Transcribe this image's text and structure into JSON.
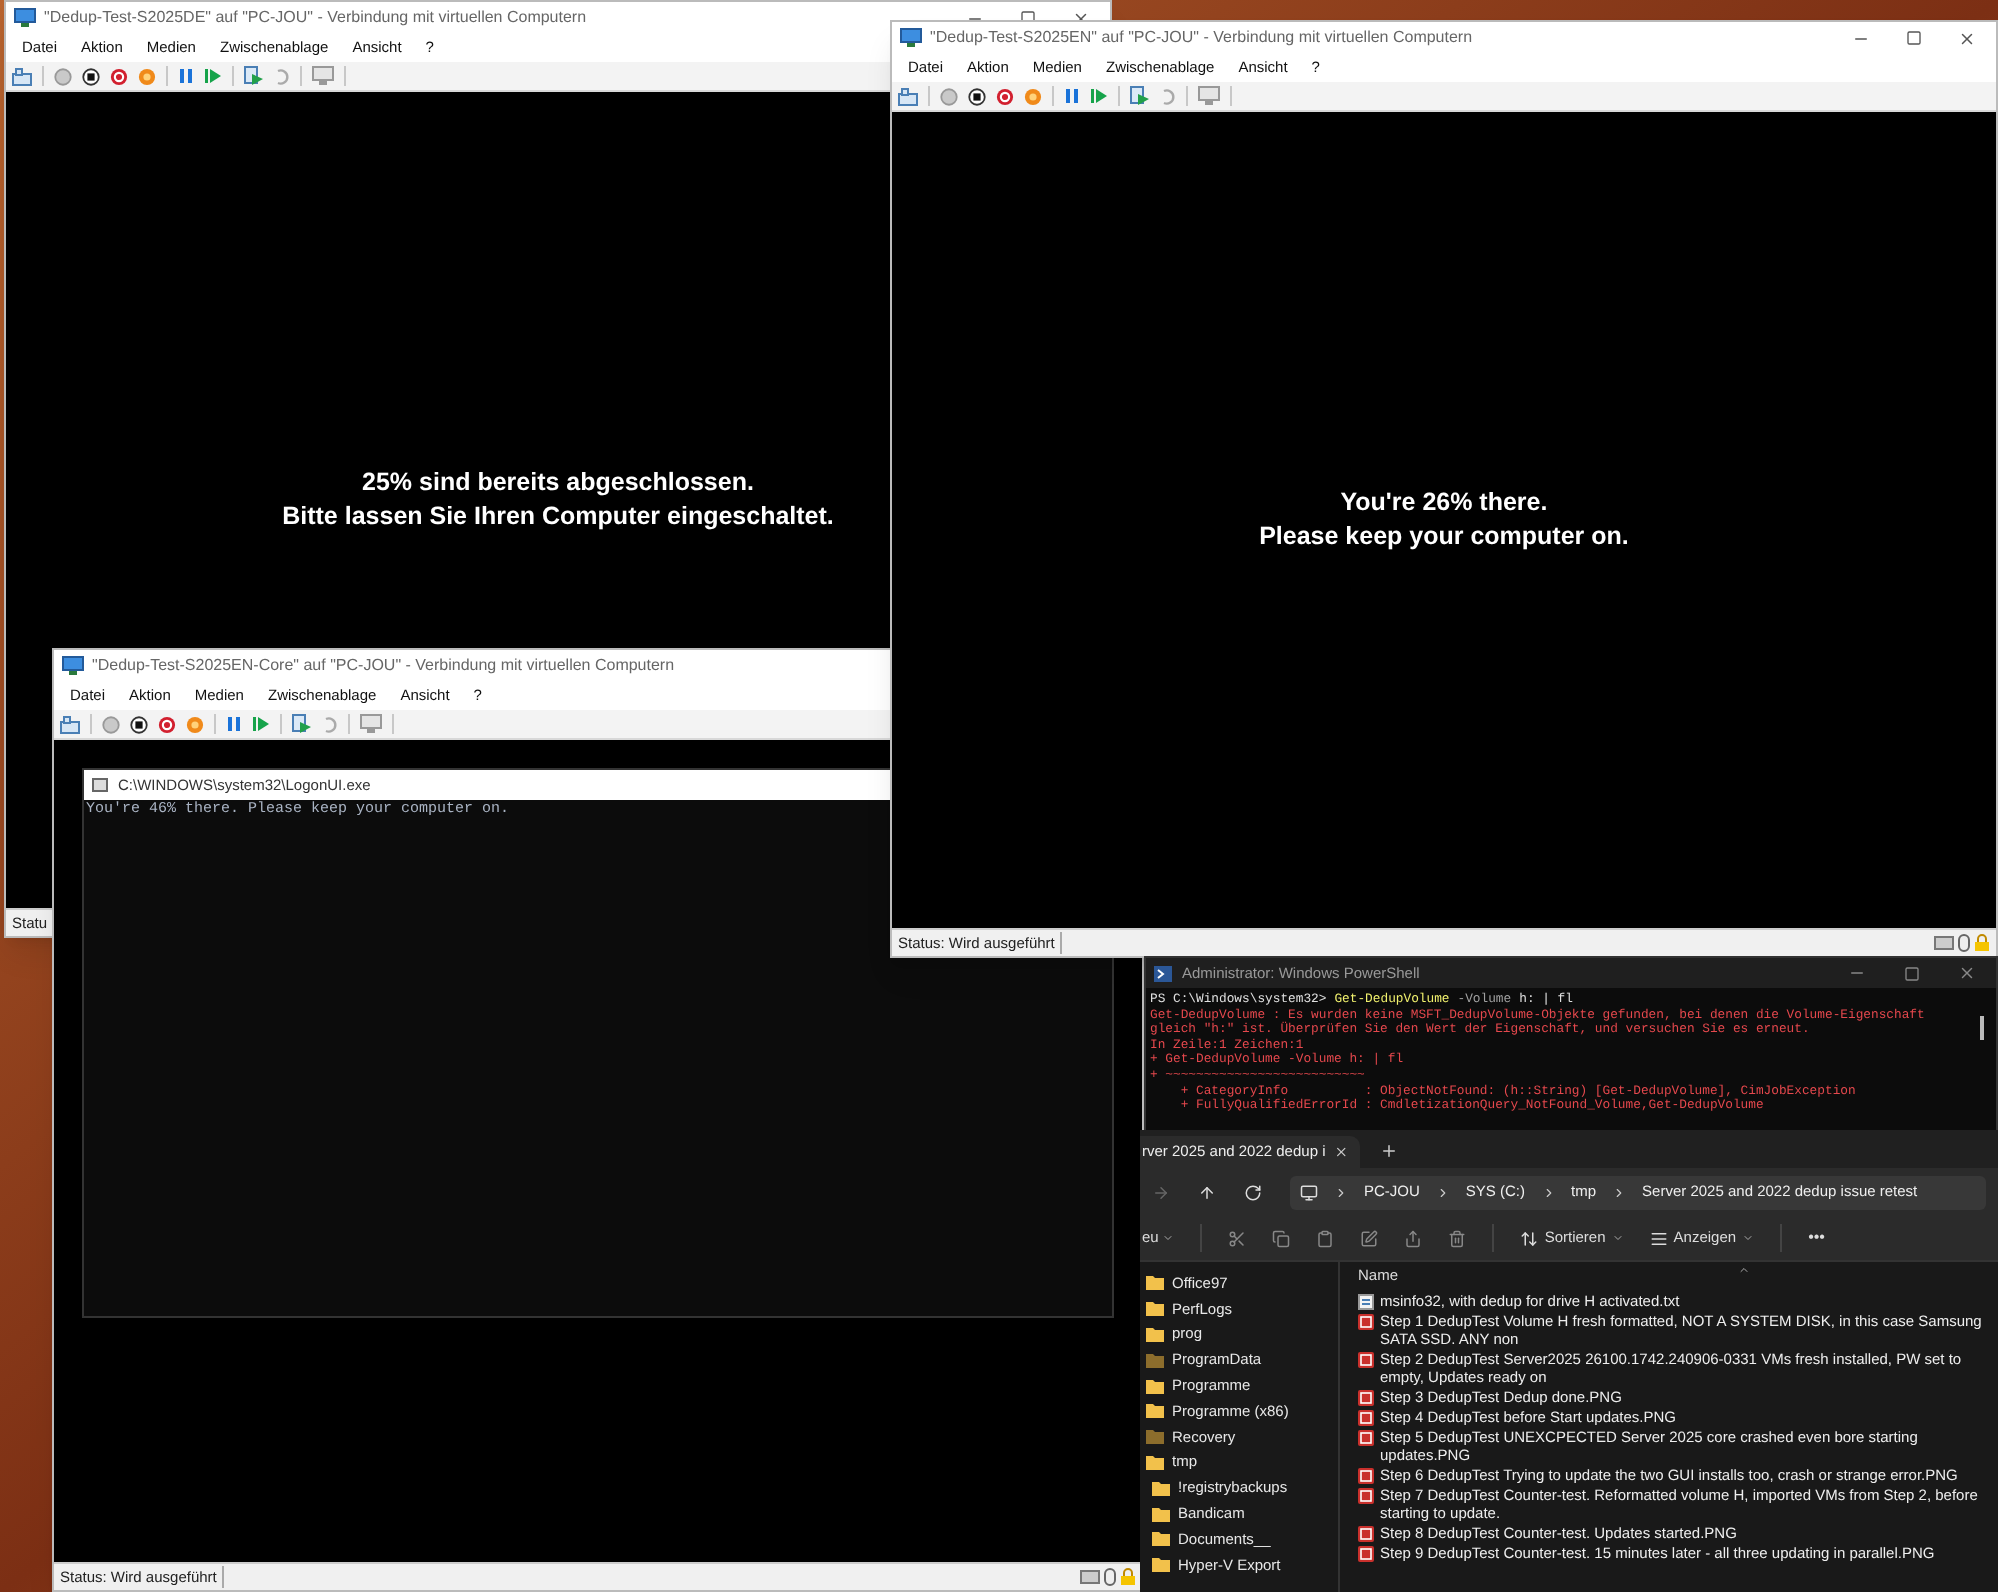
{
  "vm_windows": [
    {
      "title": "\"Dedup-Test-S2025DE\" auf \"PC-JOU\" - Verbindung mit virtuellen Computern",
      "menu": [
        "Datei",
        "Aktion",
        "Medien",
        "Zwischenablage",
        "Ansicht",
        "?"
      ],
      "screen": {
        "kind": "message",
        "lines": [
          "25% sind bereits abgeschlossen.",
          "Bitte lassen Sie Ihren Computer eingeschaltet."
        ]
      },
      "status": "Statu"
    },
    {
      "title": "\"Dedup-Test-S2025EN-Core\" auf \"PC-JOU\" - Verbindung mit virtuellen Computern",
      "menu": [
        "Datei",
        "Aktion",
        "Medien",
        "Zwischenablage",
        "Ansicht",
        "?"
      ],
      "screen": {
        "kind": "console",
        "console_title": "C:\\WINDOWS\\system32\\LogonUI.exe",
        "lines": [
          "You're 46% there. Please keep your computer on."
        ]
      },
      "status": "Status: Wird ausgeführt"
    },
    {
      "title": "\"Dedup-Test-S2025EN\" auf \"PC-JOU\" - Verbindung mit virtuellen Computern",
      "menu": [
        "Datei",
        "Aktion",
        "Medien",
        "Zwischenablage",
        "Ansicht",
        "?"
      ],
      "screen": {
        "kind": "message",
        "lines": [
          "You're 26% there.",
          "Please keep your computer on."
        ]
      },
      "status": "Status: Wird ausgeführt"
    }
  ],
  "powershell": {
    "title": "Administrator: Windows PowerShell",
    "prompt": "PS C:\\Windows\\system32>",
    "command": "Get-DedupVolume",
    "parameter": "-Volume",
    "argument": "h: | fl",
    "error_lines": [
      "Get-DedupVolume : Es wurden keine MSFT_DedupVolume-Objekte gefunden, bei denen die Volume-Eigenschaft",
      "gleich \"h:\" ist. Überprüfen Sie den Wert der Eigenschaft, und versuchen Sie es erneut.",
      "In Zeile:1 Zeichen:1",
      "+ Get-DedupVolume -Volume h: | fl",
      "+ ~~~~~~~~~~~~~~~~~~~~~~~~~~",
      "    + CategoryInfo          : ObjectNotFound: (h::String) [Get-DedupVolume], CimJobException",
      "    + FullyQualifiedErrorId : CmdletizationQuery_NotFound_Volume,Get-DedupVolume"
    ]
  },
  "explorer": {
    "tab_title": "rver 2025 and 2022 dedup i",
    "breadcrumb": [
      "PC-JOU",
      "SYS (C:)",
      "tmp",
      "Server 2025 and 2022 dedup issue retest"
    ],
    "new_menu": "eu",
    "sort": "Sortieren",
    "view": "Anzeigen",
    "more": "•••",
    "column": "Name",
    "sidebar": [
      {
        "label": "Office97",
        "hidden": false
      },
      {
        "label": "PerfLogs",
        "hidden": false
      },
      {
        "label": "prog",
        "hidden": false
      },
      {
        "label": "ProgramData",
        "hidden": true
      },
      {
        "label": "Programme",
        "hidden": false
      },
      {
        "label": "Programme (x86)",
        "hidden": false
      },
      {
        "label": "Recovery",
        "hidden": true
      },
      {
        "label": "tmp",
        "hidden": false,
        "children": [
          {
            "label": "!registrybackups",
            "hidden": false
          },
          {
            "label": "Bandicam",
            "hidden": false
          },
          {
            "label": "Documents__",
            "hidden": false
          },
          {
            "label": "Hyper-V Export",
            "hidden": false
          }
        ]
      }
    ],
    "files": [
      {
        "name": "msinfo32, with dedup for drive H activated.txt",
        "kind": "text"
      },
      {
        "name": "Step 1 DedupTest Volume H fresh formatted, NOT A SYSTEM DISK, in this case Samsung SATA SSD. ANY non",
        "kind": "image"
      },
      {
        "name": "Step 2 DedupTest Server2025 26100.1742.240906-0331 VMs fresh installed, PW set to empty, Updates ready on",
        "kind": "image"
      },
      {
        "name": "Step 3 DedupTest Dedup done.PNG",
        "kind": "image"
      },
      {
        "name": "Step 4 DedupTest before Start updates.PNG",
        "kind": "image"
      },
      {
        "name": "Step 5 DedupTest UNEXCPECTED Server 2025 core crashed even bore starting updates.PNG",
        "kind": "image"
      },
      {
        "name": "Step 6 DedupTest Trying to update the two GUI installs too, crash or strange error.PNG",
        "kind": "image"
      },
      {
        "name": "Step 7 DedupTest Counter-test. Reformatted volume H, imported VMs from Step 2, before starting to update.",
        "kind": "image"
      },
      {
        "name": "Step 8 DedupTest Counter-test. Updates started.PNG",
        "kind": "image"
      },
      {
        "name": "Step 9 DedupTest Counter-test. 15 minutes later - all three updating in parallel.PNG",
        "kind": "image"
      }
    ]
  }
}
